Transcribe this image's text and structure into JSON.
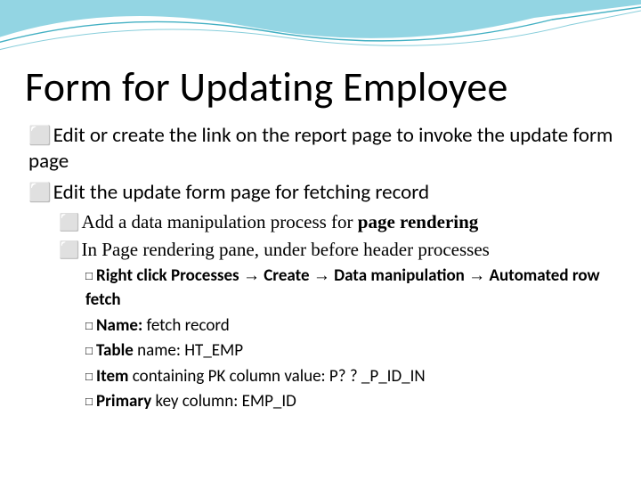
{
  "title": "Form for Updating Employee",
  "bullets": {
    "b1": "Edit or create the link on the report page to invoke the update form page",
    "b2": "Edit the update form page for fetching record",
    "s1_pre": "Add a data manipulation process for ",
    "s1_bold": "page rendering",
    "s2": "In Page rendering pane, under before header processes",
    "t1_a": "Right click Processes ",
    "t1_b": " Create ",
    "t1_c": " Data manipulation ",
    "t1_d": " Automated row fetch",
    "t2_a": "Name: ",
    "t2_b": "fetch record",
    "t3_a": "Table ",
    "t3_b": "name: HT_EMP",
    "t4_a": "Item ",
    "t4_b": "containing PK column value: P? ? _P_ID_IN",
    "t5_a": "Primary ",
    "t5_b": "key column: EMP_ID"
  },
  "glyphs": {
    "sq": "⬜",
    "sqsm": "□",
    "arrow": "→"
  }
}
